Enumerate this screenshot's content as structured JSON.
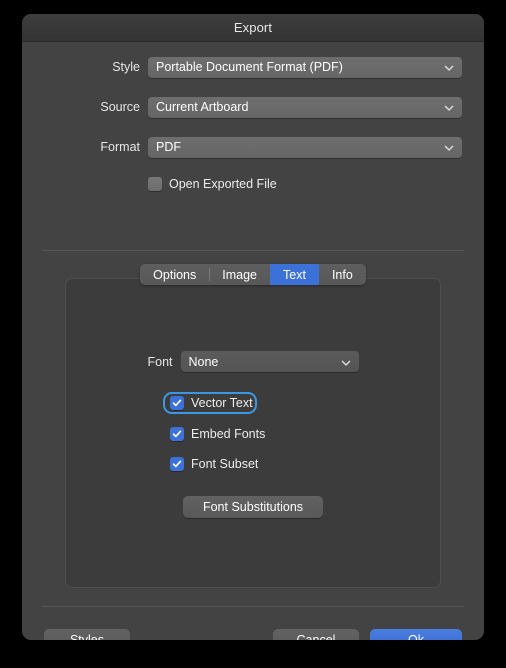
{
  "window": {
    "title": "Export"
  },
  "form": {
    "rows": [
      {
        "label": "Style",
        "value": "Portable Document Format (PDF)",
        "icon": "chevron-down-icon"
      },
      {
        "label": "Source",
        "value": "Current Artboard",
        "icon": "chevron-down-icon"
      },
      {
        "label": "Format",
        "value": "PDF",
        "icon": "chevron-down-icon"
      }
    ],
    "open_exported": {
      "label": "Open Exported File",
      "checked": false
    }
  },
  "tabs": [
    {
      "label": "Options",
      "active": false
    },
    {
      "label": "Image",
      "active": false
    },
    {
      "label": "Text",
      "active": true
    },
    {
      "label": "Info",
      "active": false
    }
  ],
  "text_panel": {
    "font": {
      "label": "Font",
      "value": "None",
      "icon": "chevron-down-icon"
    },
    "checkboxes": [
      {
        "label": "Vector Text",
        "checked": true,
        "focused": true
      },
      {
        "label": "Embed Fonts",
        "checked": true,
        "focused": false
      },
      {
        "label": "Font Subset",
        "checked": true,
        "focused": false
      }
    ],
    "substitutions_button": "Font Substitutions"
  },
  "footer": {
    "styles": "Styles",
    "cancel": "Cancel",
    "ok": "Ok"
  },
  "colors": {
    "accent": "#3c72d7",
    "focus_ring": "#3d97e0",
    "window_bg": "#434343",
    "panel_bg": "#3c3c3c",
    "control_bg": "#666666"
  }
}
